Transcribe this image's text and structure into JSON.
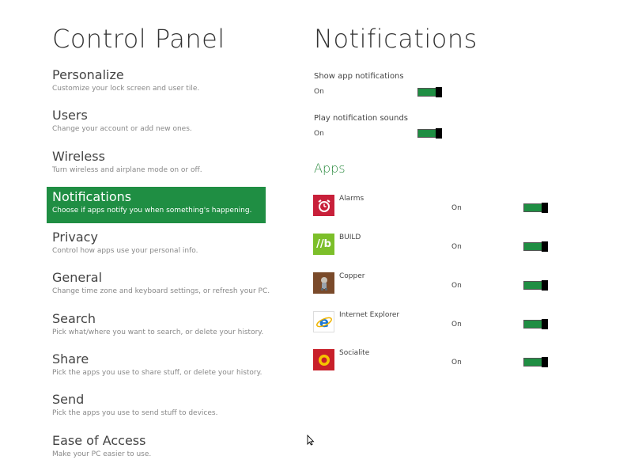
{
  "left_title": "Control Panel",
  "right_title": "Notifications",
  "nav": [
    {
      "label": "Personalize",
      "desc": "Customize your lock screen and user tile."
    },
    {
      "label": "Users",
      "desc": "Change your account or add new ones."
    },
    {
      "label": "Wireless",
      "desc": "Turn wireless and airplane mode on or off."
    },
    {
      "label": "Notifications",
      "desc": "Choose if apps notify you when something's happening.",
      "selected": true
    },
    {
      "label": "Privacy",
      "desc": "Control how apps use your personal info."
    },
    {
      "label": "General",
      "desc": "Change time zone and keyboard settings, or refresh your PC."
    },
    {
      "label": "Search",
      "desc": "Pick what/where you want to search, or delete your history."
    },
    {
      "label": "Share",
      "desc": "Pick the apps you use to share stuff, or delete your history."
    },
    {
      "label": "Send",
      "desc": "Pick the apps you use to send stuff to devices."
    },
    {
      "label": "Ease of Access",
      "desc": "Make your PC easier to use."
    }
  ],
  "settings": {
    "show_app_notifications": {
      "label": "Show app notifications",
      "state": "On"
    },
    "play_notification_sounds": {
      "label": "Play notification sounds",
      "state": "On"
    }
  },
  "apps_heading": "Apps",
  "apps": [
    {
      "name": "Alarms",
      "state": "On",
      "icon": "alarm-clock-icon",
      "color": "#c8203a"
    },
    {
      "name": "BUILD",
      "state": "On",
      "icon": "build-b-icon",
      "color": "#7cbf2a"
    },
    {
      "name": "Copper",
      "state": "On",
      "icon": "copper-character-icon",
      "color": "#7a4a2a"
    },
    {
      "name": "Internet Explorer",
      "state": "On",
      "icon": "internet-explorer-icon",
      "color": "#1e6fc4"
    },
    {
      "name": "Socialite",
      "state": "On",
      "icon": "socialite-icon",
      "color": "#c8202a"
    }
  ],
  "colors": {
    "accent": "#1f8e43",
    "apps_heading": "#2a8a3e"
  }
}
